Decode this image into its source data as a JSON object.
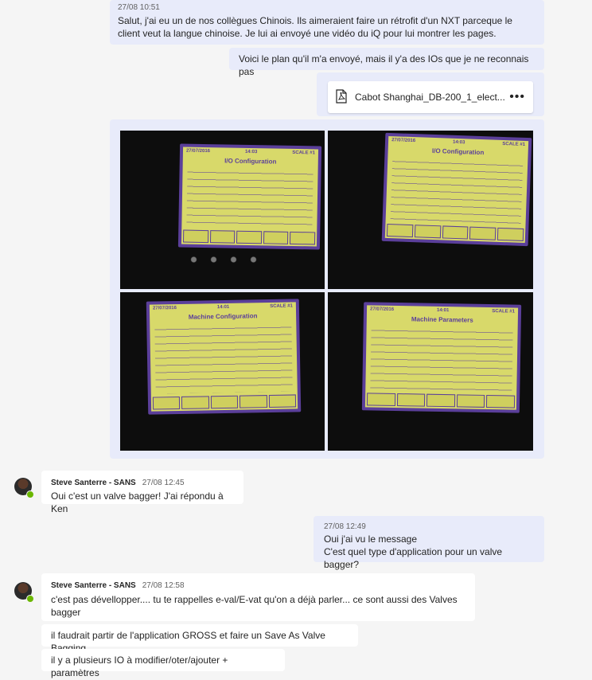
{
  "messages": {
    "m1": {
      "time": "27/08 10:51",
      "text": "Salut, j'ai eu un de nos collègues Chinois. Ils aimeraient faire un rétrofit d'un NXT parceque le client veut la langue chinoise. Je lui ai envoyé une vidéo du iQ pour lui montrer les pages."
    },
    "m2": {
      "text": "Voici le plan qu'il m'a envoyé, mais il y'a des IOs que je ne reconnais pas"
    },
    "m3": {
      "file_name": "Cabot Shanghai_DB-200_1_elect...",
      "more": "•••",
      "file_icon": "pdf-icon"
    },
    "m4": {
      "photos": [
        {
          "header_left": "27/07/2016",
          "header_mid": "14:03",
          "header_right": "SCALE #1",
          "title": "I/O Configuration"
        },
        {
          "header_left": "27/07/2016",
          "header_mid": "14:03",
          "header_right": "SCALE #1",
          "title": "I/O Configuration"
        },
        {
          "header_left": "27/07/2016",
          "header_mid": "14:01",
          "header_right": "SCALE #1",
          "title": "Machine Configuration"
        },
        {
          "header_left": "27/07/2016",
          "header_mid": "14:01",
          "header_right": "SCALE #1",
          "title": "Machine Parameters"
        }
      ]
    },
    "m5": {
      "author": "Steve Santerre - SANS",
      "time": "27/08 12:45",
      "text": "Oui c'est un valve bagger! J'ai répondu à Ken"
    },
    "m6": {
      "time": "27/08 12:49",
      "line1": "Oui j'ai vu le message",
      "line2": "C'est quel type d'application pour un valve bagger?"
    },
    "m7": {
      "author": "Steve Santerre - SANS",
      "time": "27/08 12:58",
      "text": "c'est pas dévellopper.... tu te rappelles e-val/E-vat qu'on a déjà parler... ce sont aussi des Valves bagger"
    },
    "m8": {
      "text": "il faudrait partir de l'application GROSS et faire un Save As Valve Bagging"
    },
    "m9": {
      "text": "il y a plusieurs IO à modifier/oter/ajouter + paramètres"
    }
  },
  "colors": {
    "mine_bubble": "#e8ebfa",
    "theirs_bubble": "#ffffff",
    "background": "#f5f5f5",
    "presence_available": "#6bb700"
  }
}
